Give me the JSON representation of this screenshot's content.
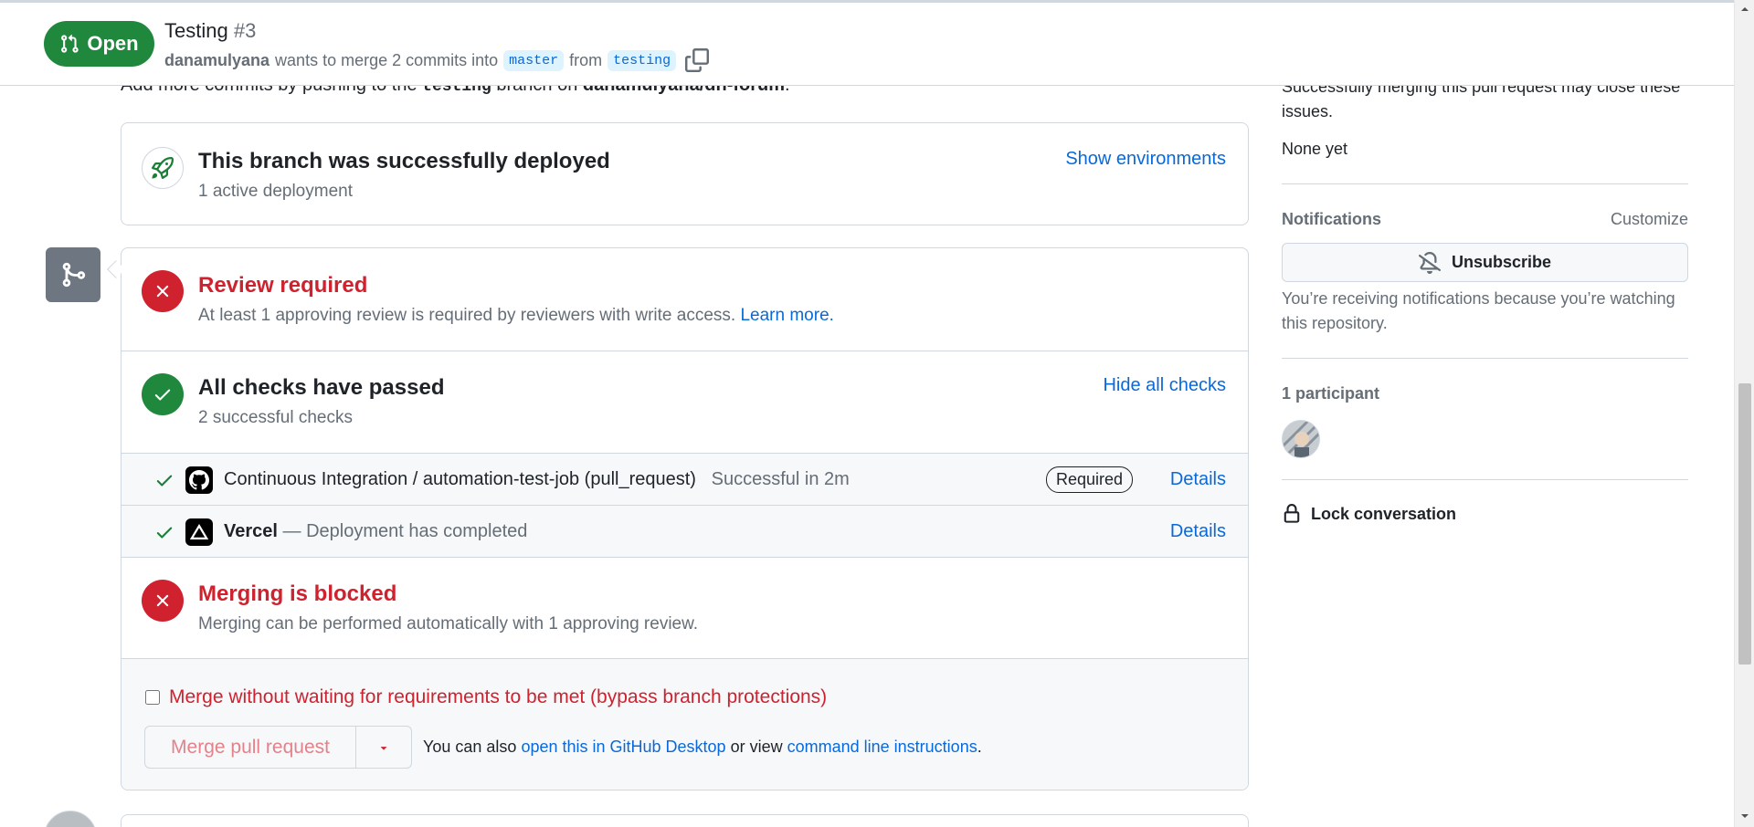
{
  "header": {
    "state": "Open",
    "title": "Testing",
    "number": "#3",
    "author": "danamulyana",
    "merge_text": "wants to merge 2 commits into",
    "base_branch": "master",
    "from_text": "from",
    "head_branch": "testing"
  },
  "partial": {
    "prefix": "Add more commits by pushing to the",
    "branch": "testing",
    "middle": "branch on",
    "repo": "danamulyana/dn-forum",
    "suffix": "."
  },
  "deployment": {
    "title": "This branch was successfully deployed",
    "subtitle": "1 active deployment",
    "action": "Show environments"
  },
  "review": {
    "title": "Review required",
    "subtitle": "At least 1 approving review is required by reviewers with write access.",
    "link": "Learn more."
  },
  "checks": {
    "title": "All checks have passed",
    "subtitle": "2 successful checks",
    "action": "Hide all checks",
    "items": [
      {
        "name": "Continuous Integration / automation-test-job (pull_request)",
        "status": "Successful in 2m",
        "badge": "Required",
        "details": "Details"
      },
      {
        "name": "Vercel",
        "status": "— Deployment has completed",
        "details": "Details"
      }
    ]
  },
  "blocked": {
    "title": "Merging is blocked",
    "subtitle": "Merging can be performed automatically with 1 approving review."
  },
  "merge": {
    "bypass_label": "Merge without waiting for requirements to be met (bypass branch protections)",
    "button": "Merge pull request",
    "also_prefix": "You can also",
    "desktop_link": "open this in GitHub Desktop",
    "or_view": "or view",
    "cli_link": "command line instructions",
    "also_suffix": "."
  },
  "sidebar": {
    "issues_text": "Successfully merging this pull request may close these issues.",
    "issues_value": "None yet",
    "notifications_heading": "Notifications",
    "customize": "Customize",
    "unsubscribe": "Unsubscribe",
    "notify_reason": "You’re receiving notifications because you’re watching this repository.",
    "participants_heading": "1 participant",
    "lock": "Lock conversation"
  },
  "colors": {
    "green": "#1f883d",
    "red": "#cf222e",
    "link": "#0969da",
    "muted": "#656d76"
  }
}
